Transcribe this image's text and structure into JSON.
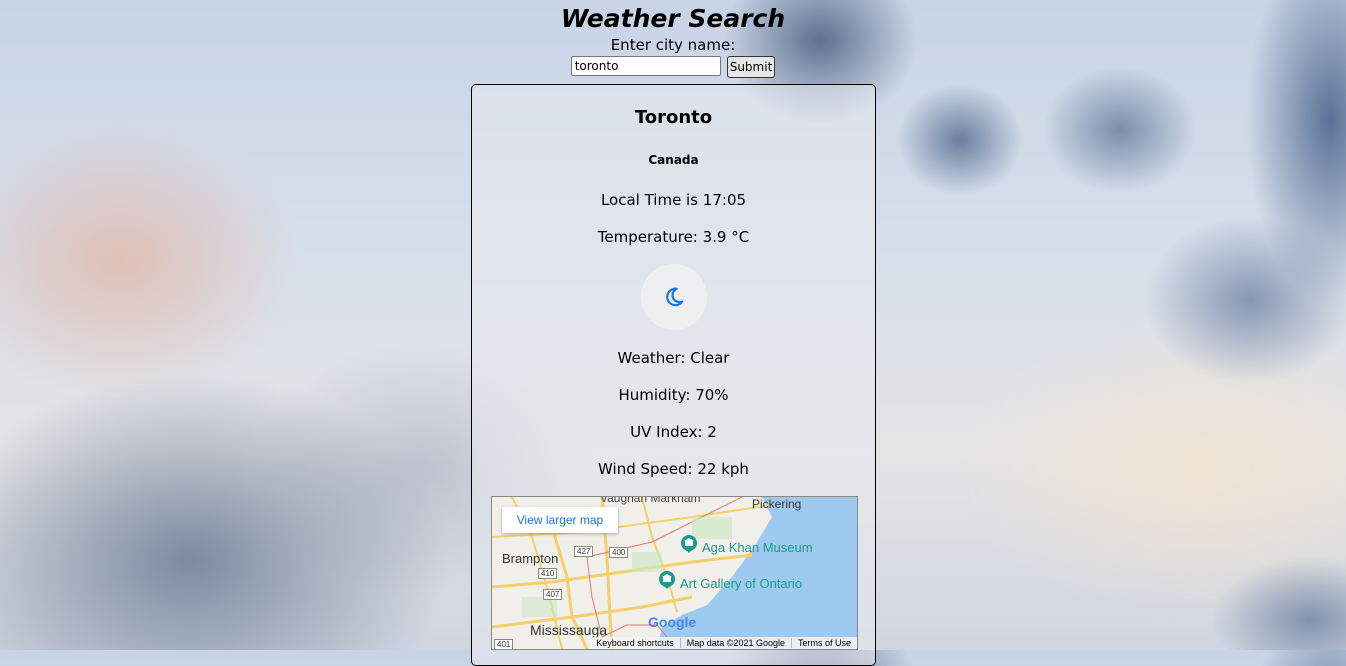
{
  "header": {
    "title": "Weather Search",
    "prompt": "Enter city name:",
    "input_value": "toronto",
    "submit_label": "Submit"
  },
  "weather": {
    "city": "Toronto",
    "country": "Canada",
    "local_time": "Local Time is 17:05",
    "temperature": "Temperature: 3.9 °C",
    "condition_icon": "crescent-moon-icon",
    "condition": "Weather: Clear",
    "humidity": "Humidity: 70%",
    "uv_index": "UV Index: 2",
    "wind_speed": "Wind Speed: 22 kph"
  },
  "map": {
    "view_larger": "View larger map",
    "labels": {
      "vaughan_markham": "Vaughan  Markham",
      "pickering": "Pickering",
      "brampton": "Brampton",
      "mississauga": "Mississauga",
      "aga_khan": "Aga Khan Museum",
      "ago": "Art Gallery of Ontario",
      "hwy_427": "427",
      "hwy_400": "400",
      "hwy_410": "410",
      "hwy_407": "407",
      "hwy_401": "401"
    },
    "logo": "Google",
    "footer": {
      "shortcuts": "Keyboard shortcuts",
      "map_data": "Map data ©2021 Google",
      "terms": "Terms of Use"
    },
    "colors": {
      "water": "#9ecaf0",
      "land": "#f1efe9",
      "road": "#f4cf6a",
      "poi": "#1a9a8a",
      "link": "#1a73e8"
    }
  }
}
